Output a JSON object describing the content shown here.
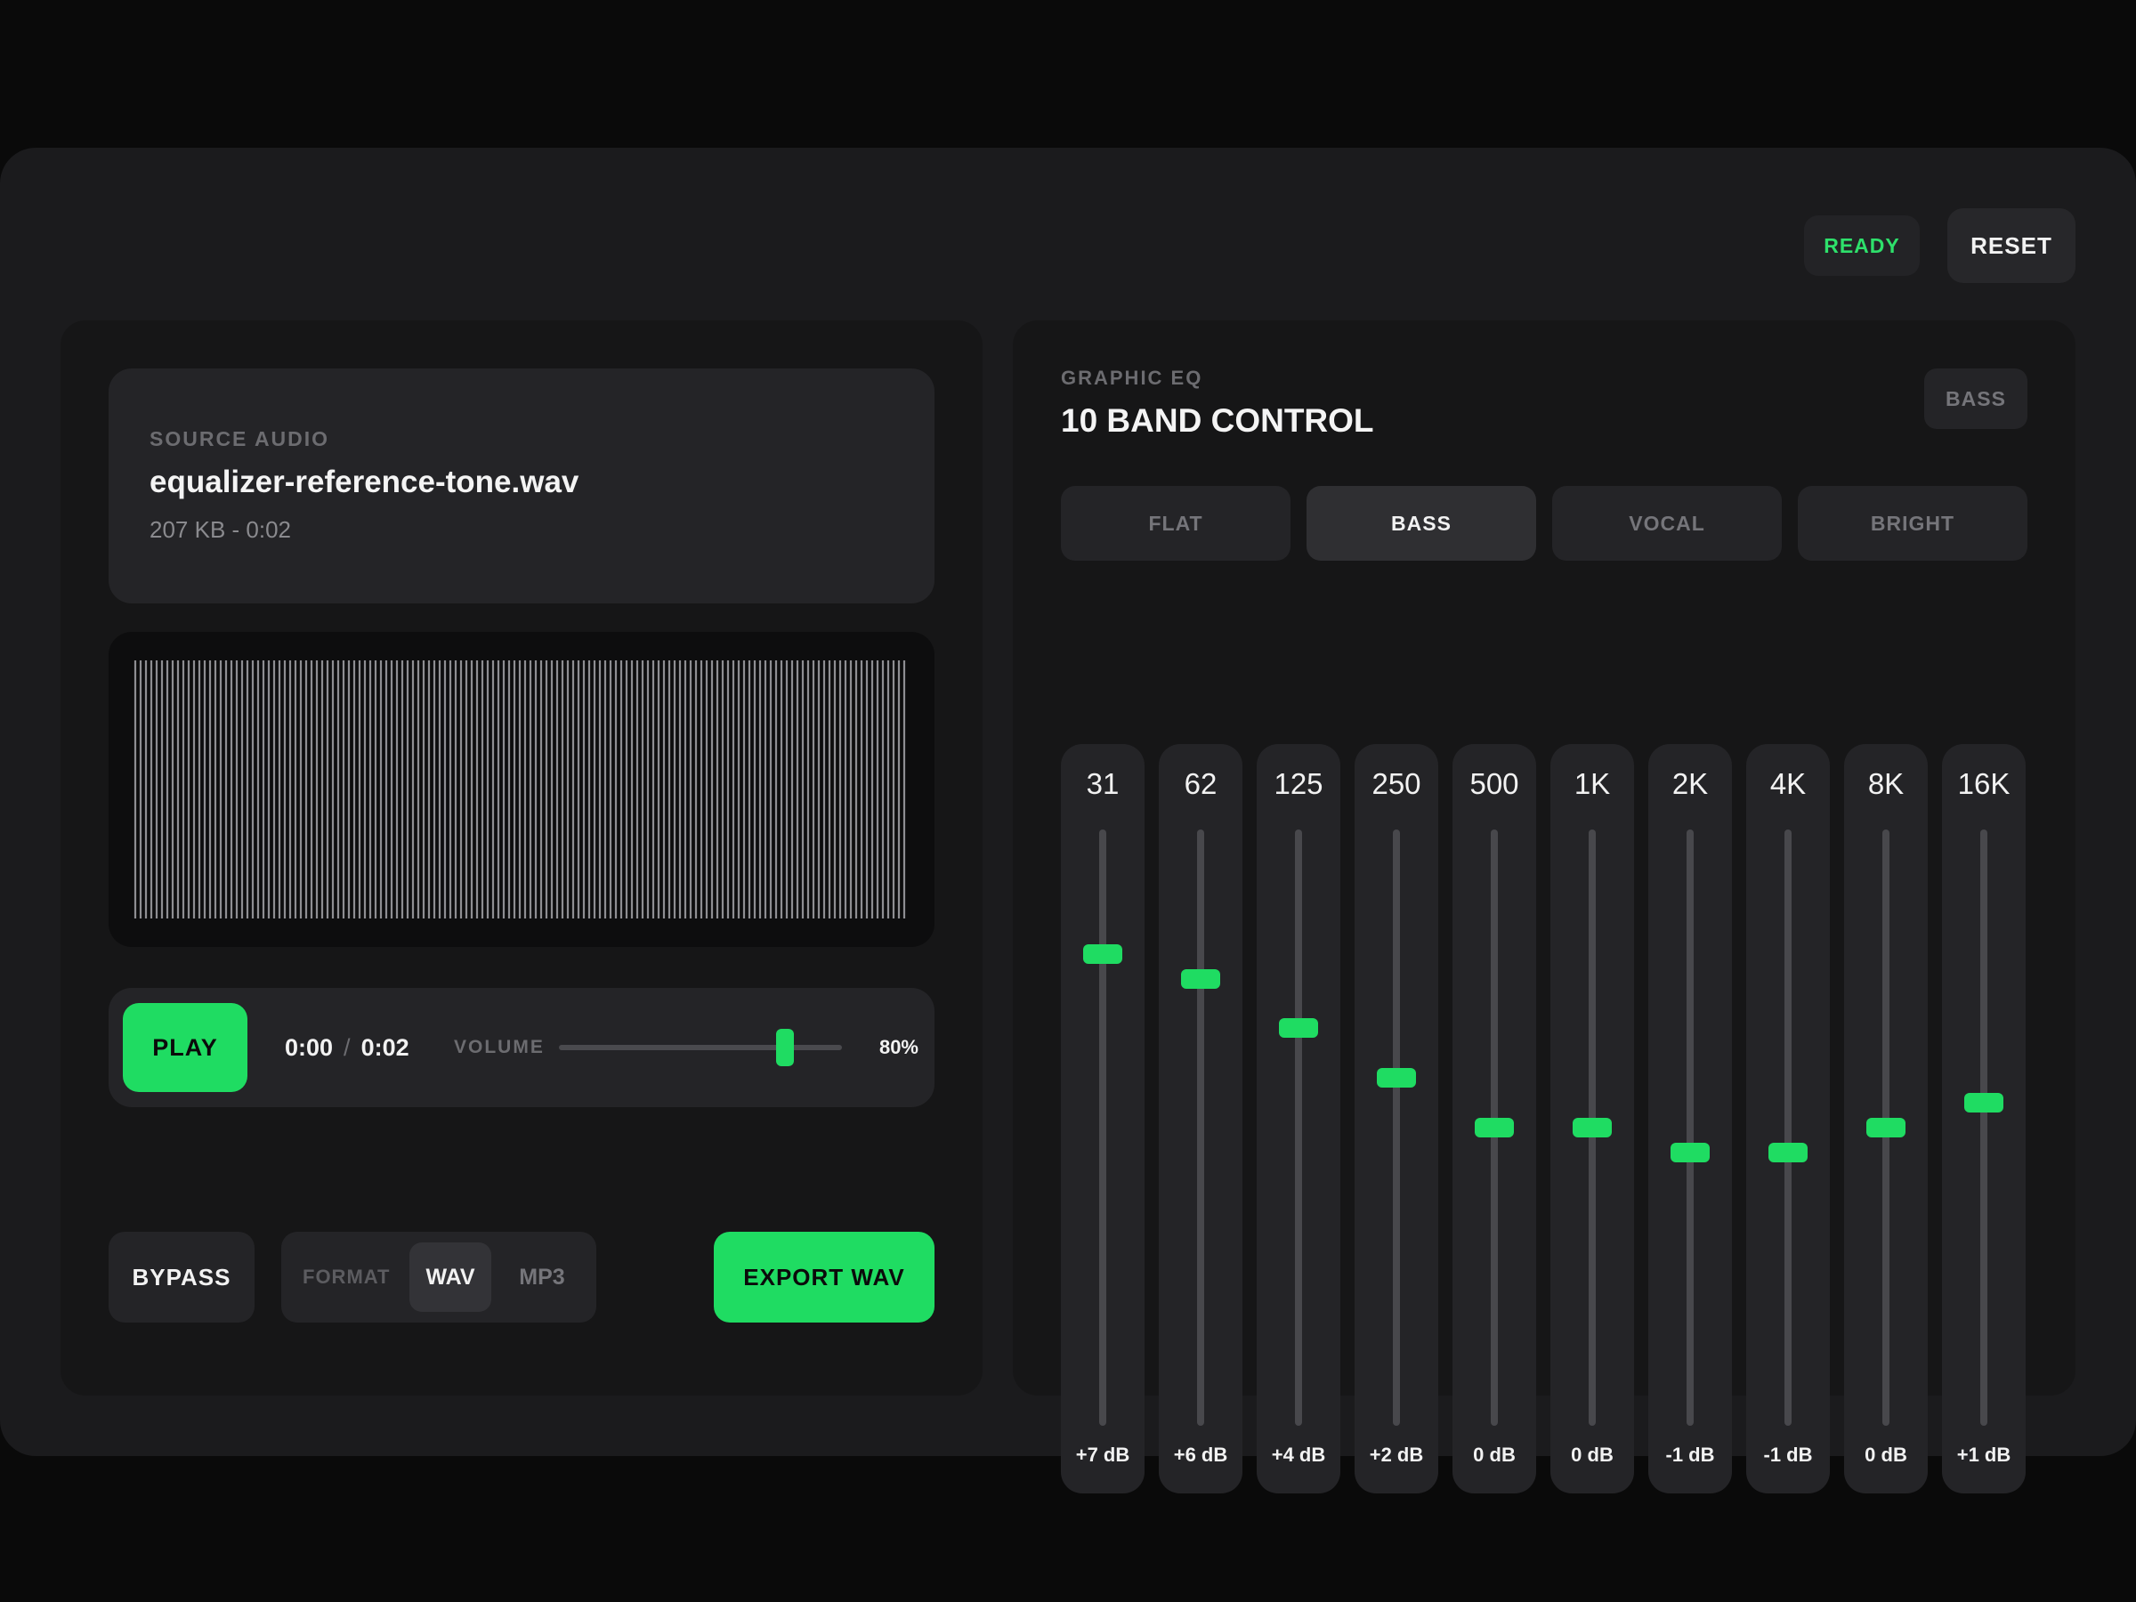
{
  "header": {
    "status": "READY",
    "reset_label": "RESET"
  },
  "source": {
    "caption": "SOURCE AUDIO",
    "filename": "equalizer-reference-tone.wav",
    "meta": "207 KB - 0:02"
  },
  "transport": {
    "play_label": "PLAY",
    "current_time": "0:00",
    "separator": "/",
    "duration": "0:02",
    "volume_label": "VOLUME",
    "volume_value": "80%",
    "volume_fraction": 0.8
  },
  "actions": {
    "bypass_label": "BYPASS",
    "format_label": "FORMAT",
    "format_options": [
      "WAV",
      "MP3"
    ],
    "format_selected": "WAV",
    "export_label": "EXPORT WAV"
  },
  "eq": {
    "caption": "GRAPHIC EQ",
    "title": "10 BAND CONTROL",
    "active_preset": "BASS",
    "presets": [
      "FLAT",
      "BASS",
      "VOCAL",
      "BRIGHT"
    ],
    "gain_range_db": [
      -12,
      12
    ],
    "bands": [
      {
        "freq": "31",
        "gain_label": "+7 dB",
        "gain_db": 7
      },
      {
        "freq": "62",
        "gain_label": "+6 dB",
        "gain_db": 6
      },
      {
        "freq": "125",
        "gain_label": "+4 dB",
        "gain_db": 4
      },
      {
        "freq": "250",
        "gain_label": "+2 dB",
        "gain_db": 2
      },
      {
        "freq": "500",
        "gain_label": "0 dB",
        "gain_db": 0
      },
      {
        "freq": "1K",
        "gain_label": "0 dB",
        "gain_db": 0
      },
      {
        "freq": "2K",
        "gain_label": "-1 dB",
        "gain_db": -1
      },
      {
        "freq": "4K",
        "gain_label": "-1 dB",
        "gain_db": -1
      },
      {
        "freq": "8K",
        "gain_label": "0 dB",
        "gain_db": 0
      },
      {
        "freq": "16K",
        "gain_label": "+1 dB",
        "gain_db": 1
      }
    ]
  },
  "colors": {
    "accent": "#1fdc62",
    "status": "#2ee06b",
    "background": "#0a0a0a",
    "surface": "#1b1b1d"
  }
}
